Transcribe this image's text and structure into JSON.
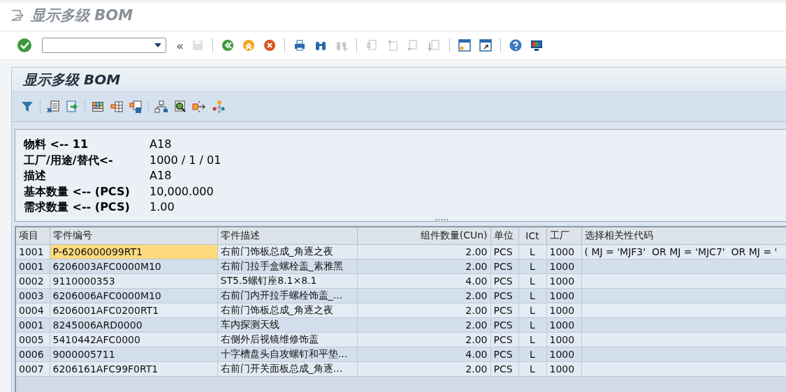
{
  "window": {
    "title": "显示多级 BOM"
  },
  "toolbar": {
    "back_chars": "«",
    "groups": [
      [
        {
          "disabled": true
        }
      ],
      [
        {
          "disabled": false
        },
        {
          "disabled": false
        },
        {
          "disabled": false
        }
      ],
      [
        {
          "disabled": false
        },
        {
          "disabled": false
        },
        {
          "disabled": true
        }
      ],
      [
        {
          "disabled": true
        },
        {
          "disabled": true
        },
        {
          "disabled": true
        },
        {
          "disabled": true
        }
      ],
      [
        {
          "disabled": false
        },
        {
          "disabled": false
        }
      ],
      [
        {
          "disabled": false
        },
        {
          "disabled": false
        }
      ]
    ]
  },
  "panel": {
    "title": "显示多级 BOM"
  },
  "header_info": [
    {
      "label": "物料 <-- 11",
      "value": "A18"
    },
    {
      "label": "工厂/用途/替代<-",
      "value": "1000 / 1 / 01"
    },
    {
      "label": "描述",
      "value": "A18"
    },
    {
      "label": "基本数量 <-- (PCS)",
      "value": "10,000.000"
    },
    {
      "label": "需求数量 <-- (PCS)",
      "value": "1.00"
    }
  ],
  "table": {
    "columns": [
      "项目",
      "零件编号",
      "零件描述",
      "组件数量(CUn)",
      "单位",
      "ICt",
      "工厂",
      "选择相关性代码"
    ],
    "rows": [
      {
        "selected": true,
        "cells": [
          "1001",
          "P-6206000099RT1",
          "右前门饰板总成_角逐之夜",
          "2.00",
          "PCS",
          "L",
          "1000",
          "( MJ = 'MJF3'  OR MJ = 'MJC7'  OR MJ = '"
        ]
      },
      {
        "selected": false,
        "cells": [
          "0001",
          "6206003AFC0000M10",
          "右前门拉手盒螺栓盖_素雅黑",
          "2.00",
          "PCS",
          "L",
          "1000"
        ]
      },
      {
        "selected": false,
        "cells": [
          "0002",
          "9110000353",
          "ST5.5螺钉座8.1×8.1",
          "4.00",
          "PCS",
          "L",
          "1000"
        ]
      },
      {
        "selected": false,
        "cells": [
          "0003",
          "6206006AFC0000M10",
          "右前门内开拉手螺栓饰盖_…",
          "2.00",
          "PCS",
          "L",
          "1000"
        ]
      },
      {
        "selected": false,
        "cells": [
          "0004",
          "6206001AFC0200RT1",
          "右前门饰板总成_角逐之夜",
          "2.00",
          "PCS",
          "L",
          "1000"
        ]
      },
      {
        "selected": false,
        "cells": [
          "0001",
          "8245006ARD0000",
          "车内探测天线",
          "2.00",
          "PCS",
          "L",
          "1000"
        ]
      },
      {
        "selected": false,
        "cells": [
          "0005",
          "5410442AFC0000",
          "右侧外后视镜维修饰盖",
          "2.00",
          "PCS",
          "L",
          "1000"
        ]
      },
      {
        "selected": false,
        "cells": [
          "0006",
          "9000005711",
          "十字槽盘头自攻螺钉和平垫…",
          "4.00",
          "PCS",
          "L",
          "1000"
        ]
      },
      {
        "selected": false,
        "cells": [
          "0007",
          "6206161AFC99F0RT1",
          "右前门开关面板总成_角逐…",
          "2.00",
          "PCS",
          "L",
          "1000"
        ]
      }
    ]
  }
}
